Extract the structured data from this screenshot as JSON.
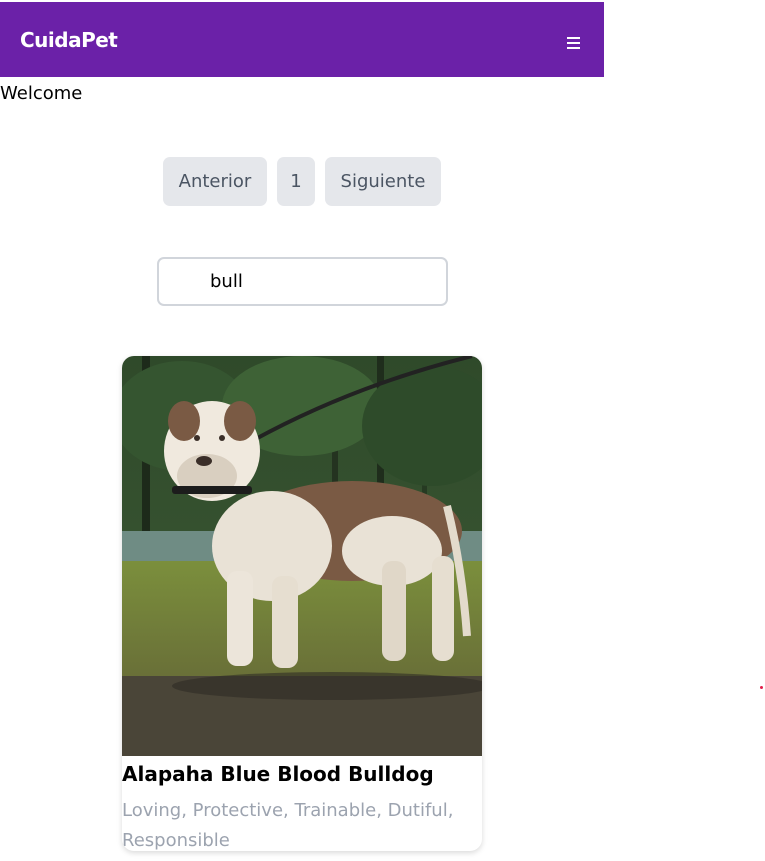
{
  "navbar": {
    "brand": "CuidaPet",
    "menu_icon": "hamburger-menu-icon",
    "bg_color": "#6b21a8"
  },
  "welcome_text": "Welcome",
  "pagination": {
    "prev_label": "Anterior",
    "page_label": "1",
    "next_label": "Siguiente"
  },
  "search": {
    "value": "bull"
  },
  "results": [
    {
      "name": "Alapaha Blue Blood Bulldog",
      "temperament": "Loving, Protective, Trainable, Dutiful, Responsible",
      "image": "dog-photo"
    }
  ]
}
